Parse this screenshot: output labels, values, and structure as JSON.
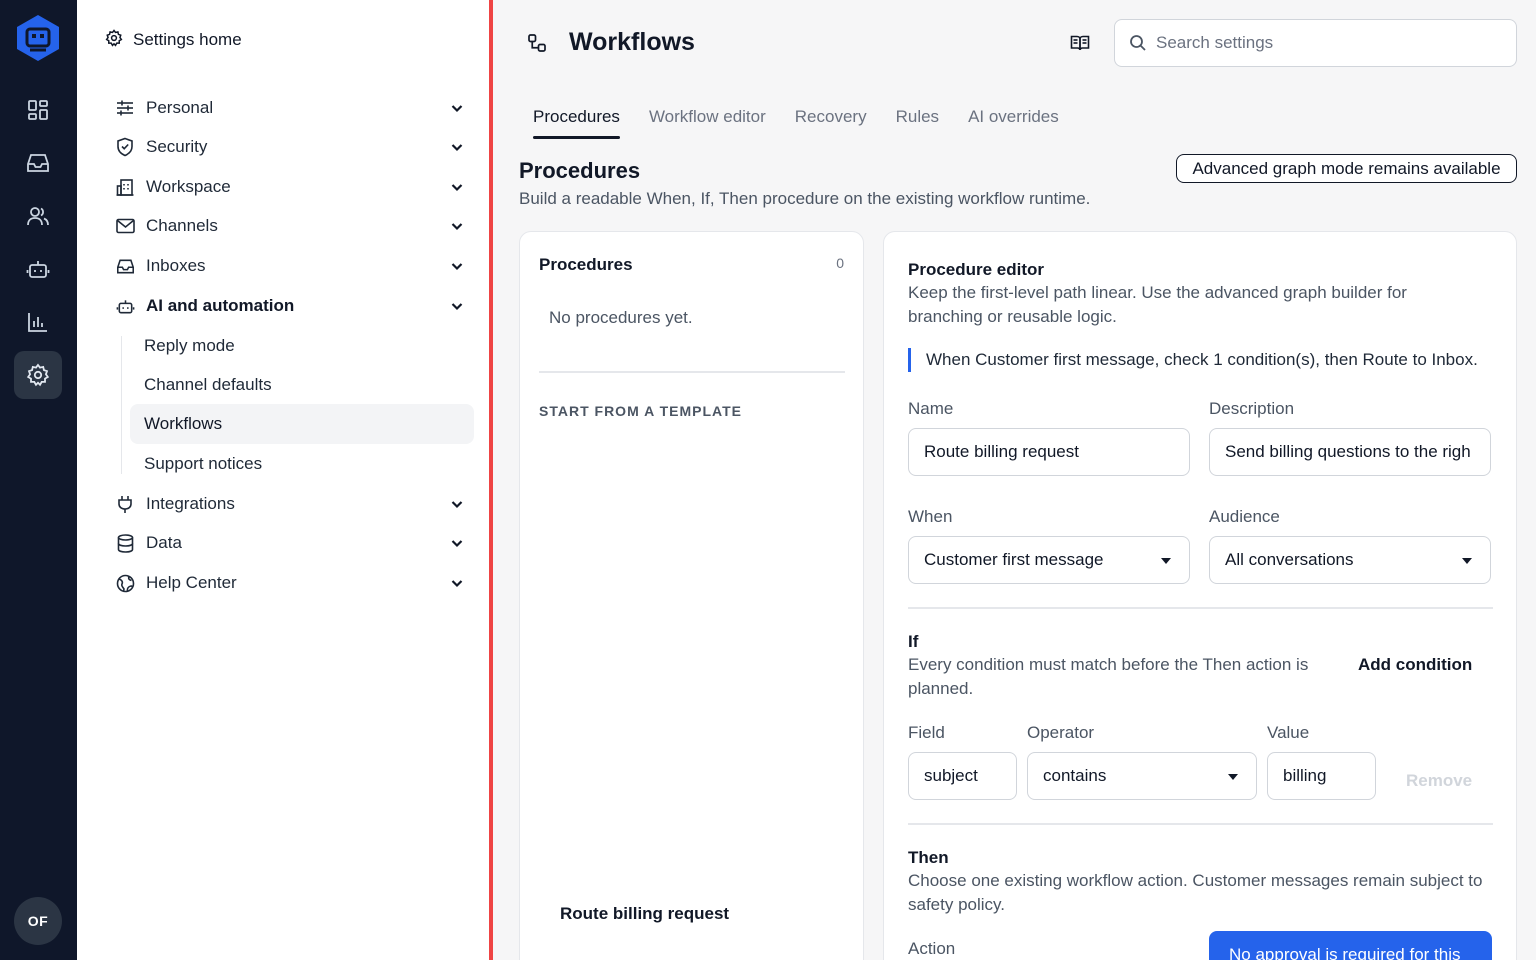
{
  "rail": {
    "avatar_initials": "OF",
    "icons": [
      "dashboard-icon",
      "inbox-icon",
      "users-icon",
      "bot-icon",
      "reports-icon",
      "settings-icon"
    ],
    "accent_color": "#2563eb"
  },
  "nav": {
    "home_label": "Settings home",
    "items": [
      {
        "label": "Personal"
      },
      {
        "label": "Security"
      },
      {
        "label": "Workspace"
      },
      {
        "label": "Channels"
      },
      {
        "label": "Inboxes"
      },
      {
        "label": "AI and automation"
      },
      {
        "label": "Integrations"
      },
      {
        "label": "Data"
      },
      {
        "label": "Help Center"
      }
    ],
    "subitems": [
      {
        "label": "Reply mode"
      },
      {
        "label": "Channel defaults"
      },
      {
        "label": "Workflows"
      },
      {
        "label": "Support notices"
      }
    ]
  },
  "header": {
    "title": "Workflows",
    "search_placeholder": "Search settings"
  },
  "tabs": [
    {
      "label": "Procedures"
    },
    {
      "label": "Workflow editor"
    },
    {
      "label": "Recovery"
    },
    {
      "label": "Rules"
    },
    {
      "label": "AI overrides"
    }
  ],
  "section": {
    "title": "Procedures",
    "subtitle": "Build a readable When, If, Then procedure on the existing workflow runtime.",
    "badge": "Advanced graph mode remains available"
  },
  "procedures_list": {
    "title": "Procedures",
    "count": "0",
    "empty_text": "No procedures yet.",
    "template_heading": "START FROM A TEMPLATE",
    "template_name": "Route billing request"
  },
  "editor": {
    "title": "Procedure editor",
    "description": "Keep the first-level path linear. Use the advanced graph builder for branching or reusable logic.",
    "summary": "When Customer first message, check 1 condition(s), then Route to Inbox.",
    "name_label": "Name",
    "name_value": "Route billing request",
    "description_label": "Description",
    "description_value": "Send billing questions to the righ",
    "when_label": "When",
    "when_value": "Customer first message",
    "audience_label": "Audience",
    "audience_value": "All conversations",
    "if_title": "If",
    "if_description": "Every condition must match before the Then action is planned.",
    "add_condition": "Add condition",
    "field_label": "Field",
    "field_value": "subject",
    "operator_label": "Operator",
    "operator_value": "contains",
    "value_label": "Value",
    "value_value": "billing",
    "remove_label": "Remove",
    "then_title": "Then",
    "then_description": "Choose one existing workflow action. Customer messages remain subject to safety policy.",
    "action_label": "Action",
    "action_button": "No approval is required for this"
  }
}
